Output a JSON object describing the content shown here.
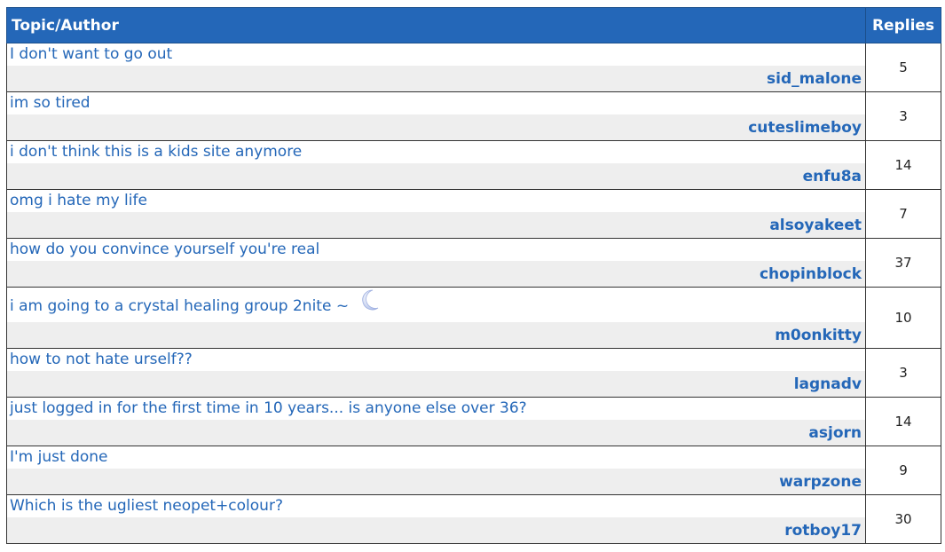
{
  "table": {
    "header_topic": "Topic/Author",
    "header_replies": "Replies"
  },
  "topics": [
    {
      "title": "I don't want to go out",
      "author": "sid_malone",
      "replies": "5"
    },
    {
      "title": "im so tired",
      "author": "cuteslimeboy",
      "replies": "3"
    },
    {
      "title": "i don't think this is a kids site anymore",
      "author": "enfu8a",
      "replies": "14"
    },
    {
      "title": "omg i hate my life",
      "author": "alsoyakeet",
      "replies": "7"
    },
    {
      "title": "how do you convince yourself you're real",
      "author": "chopinblock",
      "replies": "37"
    },
    {
      "title": "i am going to a crystal healing group 2nite ~",
      "author": "m0onkitty",
      "replies": "10",
      "icon": "crescent-moon-icon"
    },
    {
      "title": "how to not hate urself??",
      "author": "lagnadv",
      "replies": "3"
    },
    {
      "title": "just logged in for the first time in 10 years... is anyone else over 36?",
      "author": "asjorn",
      "replies": "14"
    },
    {
      "title": "I'm just done",
      "author": "warpzone",
      "replies": "9"
    },
    {
      "title": "Which is the ugliest neopet+colour?",
      "author": "rotboy17",
      "replies": "30"
    }
  ],
  "colors": {
    "header_bg": "#2467b8",
    "link": "#2467b8",
    "author_bg": "#eeeeee"
  }
}
